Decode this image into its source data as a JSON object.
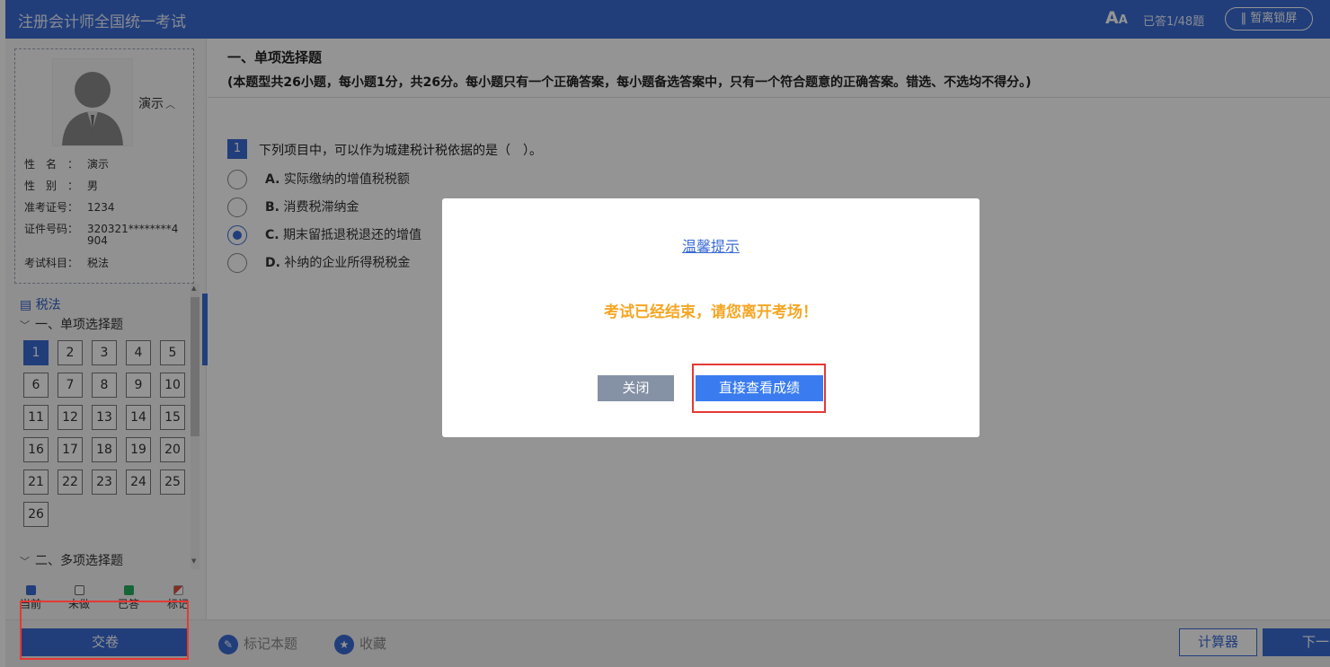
{
  "header": {
    "title": "注册会计师全国统一考试",
    "font_icon": "A",
    "font_icon_small": "A",
    "answered": "已答1/48题",
    "lock_screen": "‖ 暂离锁屏"
  },
  "sidebar": {
    "user_name": "演示",
    "info": [
      {
        "label": "性　名　：",
        "value": "演示"
      },
      {
        "label": "性　别　：",
        "value": "男"
      },
      {
        "label": "准考证号：",
        "value": "1234"
      },
      {
        "label": "证件号码：",
        "value": "320321********4904"
      },
      {
        "label": "考试科目：",
        "value": "税法"
      }
    ],
    "subject": "税法",
    "section1": "一、单项选择题",
    "section2": "二、多项选择题",
    "numbers": [
      "1",
      "2",
      "3",
      "4",
      "5",
      "6",
      "7",
      "8",
      "9",
      "10",
      "11",
      "12",
      "13",
      "14",
      "15",
      "16",
      "17",
      "18",
      "19",
      "20",
      "21",
      "22",
      "23",
      "24",
      "25",
      "26"
    ],
    "current_number": "1",
    "legend": [
      {
        "label": "当前",
        "color": "#3a6bd4"
      },
      {
        "label": "未做",
        "color": "#ffffff"
      },
      {
        "label": "已答",
        "color": "#27ae60"
      },
      {
        "label": "标记",
        "color": "#e74c3c"
      }
    ],
    "submit": "交卷"
  },
  "main": {
    "section_title": "一、单项选择题",
    "section_desc": "(本题型共26小题，每小题1分，共26分。每小题只有一个正确答案，每小题备选答案中，只有一个符合题意的正确答案。错选、不选均不得分。)",
    "question_number": "1",
    "question_text": "下列项目中，可以作为城建税计税依据的是（　）。",
    "options": [
      {
        "letter": "A.",
        "text": "实际缴纳的增值税税额",
        "checked": false
      },
      {
        "letter": "B.",
        "text": "消费税滞纳金",
        "checked": false
      },
      {
        "letter": "C.",
        "text": "期末留抵退税退还的增值",
        "checked": true
      },
      {
        "letter": "D.",
        "text": "补纳的企业所得税税金",
        "checked": false
      }
    ]
  },
  "footer": {
    "mark": "标记本题",
    "favorite": "收藏",
    "calculator": "计算器",
    "next": "下一"
  },
  "modal": {
    "title": "温馨提示",
    "message": "考试已经结束，请您离开考场！",
    "close": "关闭",
    "view_results": "直接查看成绩"
  }
}
